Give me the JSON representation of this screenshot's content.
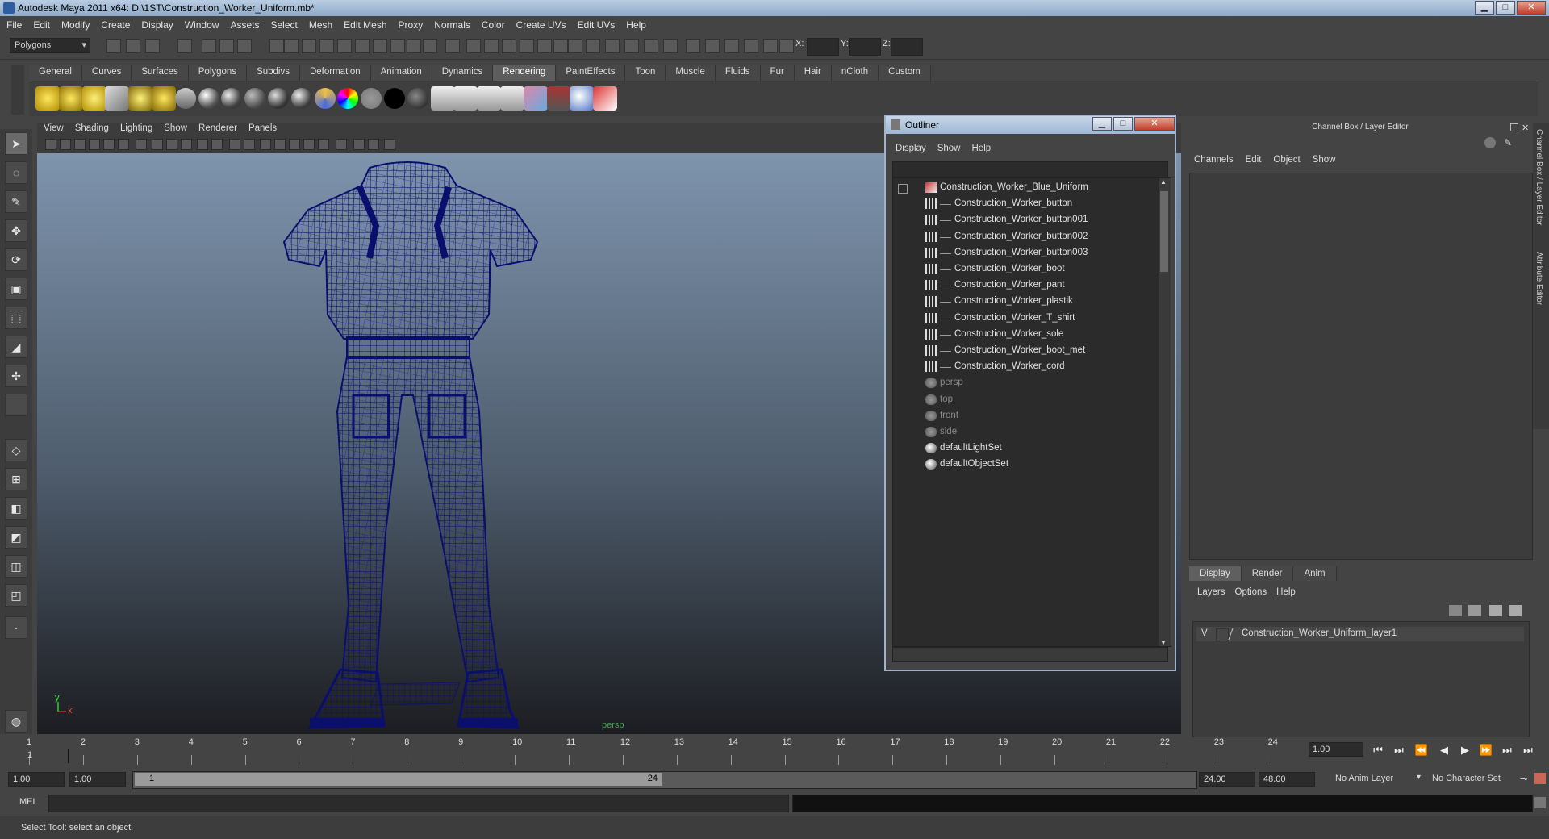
{
  "window": {
    "title": "Autodesk Maya 2011 x64: D:\\1ST\\Construction_Worker_Uniform.mb*",
    "min_icon": "minimize-icon",
    "max_icon": "maximize-icon",
    "close_label": "✕"
  },
  "menubar": [
    "File",
    "Edit",
    "Modify",
    "Create",
    "Display",
    "Window",
    "Assets",
    "Select",
    "Mesh",
    "Edit Mesh",
    "Proxy",
    "Normals",
    "Color",
    "Create UVs",
    "Edit UVs",
    "Help"
  ],
  "status_line": {
    "mode": "Polygons",
    "x_label": "X:",
    "y_label": "Y:",
    "z_label": "Z:"
  },
  "shelf_tabs": [
    "General",
    "Curves",
    "Surfaces",
    "Polygons",
    "Subdivs",
    "Deformation",
    "Animation",
    "Dynamics",
    "Rendering",
    "PaintEffects",
    "Toon",
    "Muscle",
    "Fluids",
    "Fur",
    "Hair",
    "nCloth",
    "Custom"
  ],
  "shelf_active_tab": "Rendering",
  "viewport": {
    "menu": [
      "View",
      "Shading",
      "Lighting",
      "Show",
      "Renderer",
      "Panels"
    ],
    "camera_label": "persp",
    "axis_y": "y",
    "axis_x": "x",
    "wire_color": "#0a0f6e"
  },
  "outliner": {
    "title": "Outliner",
    "menu": [
      "Display",
      "Show",
      "Help"
    ],
    "items": [
      {
        "label": "Construction_Worker_Blue_Uniform",
        "level": 0,
        "kind": "group",
        "dim": false
      },
      {
        "label": "Construction_Worker_button",
        "level": 1,
        "kind": "mesh",
        "dim": false
      },
      {
        "label": "Construction_Worker_button001",
        "level": 1,
        "kind": "mesh",
        "dim": false
      },
      {
        "label": "Construction_Worker_button002",
        "level": 1,
        "kind": "mesh",
        "dim": false
      },
      {
        "label": "Construction_Worker_button003",
        "level": 1,
        "kind": "mesh",
        "dim": false
      },
      {
        "label": "Construction_Worker_boot",
        "level": 1,
        "kind": "mesh",
        "dim": false
      },
      {
        "label": "Construction_Worker_pant",
        "level": 1,
        "kind": "mesh",
        "dim": false
      },
      {
        "label": "Construction_Worker_plastik",
        "level": 1,
        "kind": "mesh",
        "dim": false
      },
      {
        "label": "Construction_Worker_T_shirt",
        "level": 1,
        "kind": "mesh",
        "dim": false
      },
      {
        "label": "Construction_Worker_sole",
        "level": 1,
        "kind": "mesh",
        "dim": false
      },
      {
        "label": "Construction_Worker_boot_met",
        "level": 1,
        "kind": "mesh",
        "dim": false
      },
      {
        "label": "Construction_Worker_cord",
        "level": 1,
        "kind": "mesh",
        "dim": false
      },
      {
        "label": "persp",
        "level": 0,
        "kind": "camera",
        "dim": true
      },
      {
        "label": "top",
        "level": 0,
        "kind": "camera",
        "dim": true
      },
      {
        "label": "front",
        "level": 0,
        "kind": "camera",
        "dim": true
      },
      {
        "label": "side",
        "level": 0,
        "kind": "camera",
        "dim": true
      },
      {
        "label": "defaultLightSet",
        "level": 0,
        "kind": "set",
        "dim": false
      },
      {
        "label": "defaultObjectSet",
        "level": 0,
        "kind": "set",
        "dim": false
      }
    ]
  },
  "channel_box": {
    "title": "Channel Box / Layer Editor",
    "menu": [
      "Channels",
      "Edit",
      "Object",
      "Show"
    ],
    "layer_tabs": [
      "Display",
      "Render",
      "Anim"
    ],
    "layer_menu": [
      "Layers",
      "Options",
      "Help"
    ],
    "layer": {
      "visible": "V",
      "name": "Construction_Worker_Uniform_layer1"
    },
    "side_tabs": [
      "Channel Box / Layer Editor",
      "Attribute Editor"
    ]
  },
  "time_slider": {
    "ticks": [
      "1",
      "2",
      "3",
      "4",
      "5",
      "6",
      "7",
      "8",
      "9",
      "10",
      "11",
      "12",
      "13",
      "14",
      "15",
      "16",
      "17",
      "18",
      "19",
      "20",
      "21",
      "22",
      "23",
      "24"
    ],
    "current_frame": "1",
    "current_time": "1.00"
  },
  "range_slider": {
    "start": "1.00",
    "anim_start": "1.00",
    "range_start": "1",
    "range_end": "24",
    "anim_end": "24.00",
    "end": "48.00",
    "anim_layer": "No Anim Layer",
    "character_set": "No Character Set"
  },
  "command_line": {
    "label": "MEL"
  },
  "help_line": {
    "text": "Select Tool: select an object"
  }
}
